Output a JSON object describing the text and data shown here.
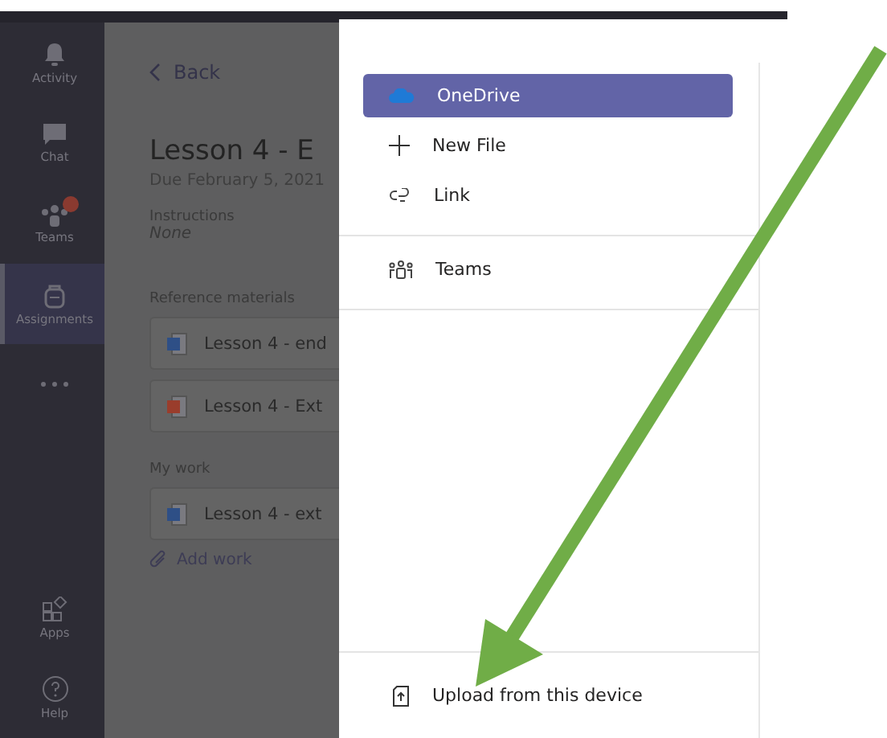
{
  "rail": {
    "items": [
      {
        "label": "Activity",
        "selected": false
      },
      {
        "label": "Chat",
        "selected": false
      },
      {
        "label": "Teams",
        "selected": false,
        "badge": true
      },
      {
        "label": "Assignments",
        "selected": true
      },
      {
        "selected": false
      }
    ],
    "bottom": [
      {
        "label": "Apps"
      },
      {
        "label": "Help"
      }
    ]
  },
  "assignment": {
    "back": "Back",
    "title": "Lesson 4 - E",
    "due": "Due February 5, 2021",
    "instructions_label": "Instructions",
    "instructions": "None",
    "reference_label": "Reference materials",
    "reference_files": [
      {
        "name": "Lesson 4 - end",
        "kind": "word"
      },
      {
        "name": "Lesson 4 - Ext",
        "kind": "powerpoint"
      }
    ],
    "my_work_label": "My work",
    "my_work_files": [
      {
        "name": "Lesson 4 - ext",
        "kind": "word"
      }
    ],
    "add_work": "Add work"
  },
  "attach_menu": {
    "sections": [
      [
        {
          "label": "OneDrive",
          "selected": true
        },
        {
          "label": "New File",
          "selected": false
        },
        {
          "label": "Link",
          "selected": false
        }
      ],
      [
        {
          "label": "Teams",
          "selected": false
        }
      ]
    ],
    "upload": "Upload from this device"
  }
}
